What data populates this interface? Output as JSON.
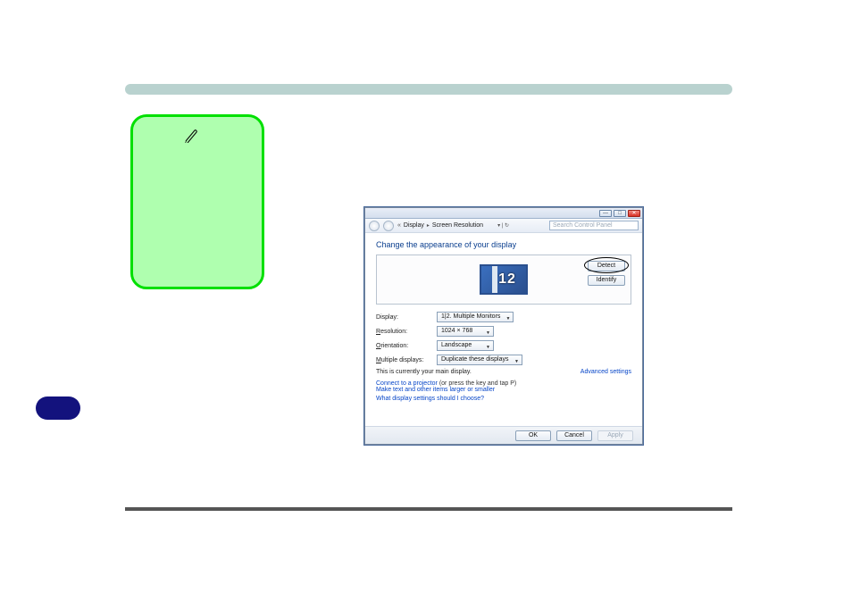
{
  "decor": {
    "pen_icon": "pen-icon"
  },
  "window": {
    "titlebar": {
      "min": "—",
      "max": "□",
      "close": "✕"
    },
    "nav": {
      "back": "back",
      "fwd": "forward",
      "breadcrumb_prefix": "«",
      "breadcrumb_1": "Display",
      "breadcrumb_2": "Screen Resolution",
      "search_placeholder": "Search Control Panel"
    },
    "heading": "Change the appearance of your display",
    "preview": {
      "monitor1": "1",
      "monitor2": "2",
      "detect": "Detect",
      "identify": "Identify"
    },
    "rows": {
      "display_label_pre": "D",
      "display_label_post": "isplay:",
      "display_value": "1|2. Multiple Monitors",
      "resolution_label_pre": "R",
      "resolution_label_post": "esolution:",
      "resolution_value": "1024 × 768",
      "orientation_label_pre": "O",
      "orientation_label_post": "rientation:",
      "orientation_value": "Landscape",
      "multiple_label_pre": "M",
      "multiple_label_post": "ultiple displays:",
      "multiple_value": "Duplicate these displays"
    },
    "main_display_note": "This is currently your main display.",
    "advanced": "Advanced settings",
    "links": {
      "projector_link": "Connect to a projector",
      "projector_hint": " (or press the      key and tap P)",
      "larger_smaller": "Make text and other items larger or smaller",
      "help": "What display settings should I choose?"
    },
    "footer": {
      "ok": "OK",
      "cancel": "Cancel",
      "apply": "Apply"
    }
  }
}
